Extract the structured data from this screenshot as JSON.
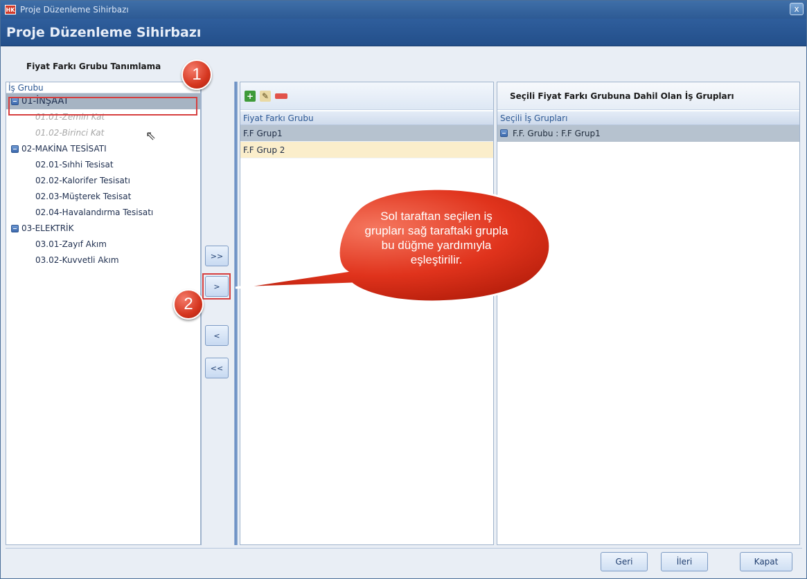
{
  "window": {
    "title": "Proje Düzenleme Sihirbazı",
    "app_icon": "HK",
    "close_label": "x",
    "header": "Proje Düzenleme Sihirbazı"
  },
  "section_title": "Fiyat Farkı Grubu Tanımlama",
  "tree": {
    "header": "İş Grubu",
    "nodes": [
      {
        "label": "01-İNŞAAT"
      },
      {
        "label": "01.01-Zemin Kat"
      },
      {
        "label": "01.02-Birinci Kat"
      },
      {
        "label": "02-MAKİNA TESİSATI"
      },
      {
        "label": "02.01-Sıhhi Tesisat"
      },
      {
        "label": "02.02-Kalorifer Tesisatı"
      },
      {
        "label": "02.03-Müşterek Tesisat"
      },
      {
        "label": "02.04-Havalandırma Tesisatı"
      },
      {
        "label": "03-ELEKTRİK"
      },
      {
        "label": "03.01-Zayıf Akım"
      },
      {
        "label": "03.02-Kuvvetli Akım"
      }
    ]
  },
  "move_buttons": {
    "add_all": ">>",
    "add_one": ">",
    "remove_one": "<",
    "remove_all": "<<"
  },
  "groups_grid": {
    "toolbar": [
      "add-icon",
      "edit-icon",
      "delete-icon"
    ],
    "header": "Fiyat Farkı Grubu",
    "rows": [
      "F.F Grup1",
      "F.F Grup 2"
    ]
  },
  "assigned": {
    "title": "Seçili Fiyat Farkı Grubuna Dahil Olan İş Grupları",
    "header": "Seçili İş Grupları",
    "rows": [
      "F.F. Grubu : F.F Grup1"
    ]
  },
  "footer": {
    "back": "Geri",
    "next": "İleri",
    "close": "Kapat"
  },
  "annotations": {
    "badge1": "1",
    "badge2": "2",
    "callout": "Sol taraftan seçilen iş grupları sağ taraftaki grupla bu düğme yardımıyla eşleştirilir."
  },
  "colors": {
    "header_bg": "#2f5e9c",
    "highlight_red": "#d63e3e",
    "selected_row": "#a6b4c3"
  }
}
